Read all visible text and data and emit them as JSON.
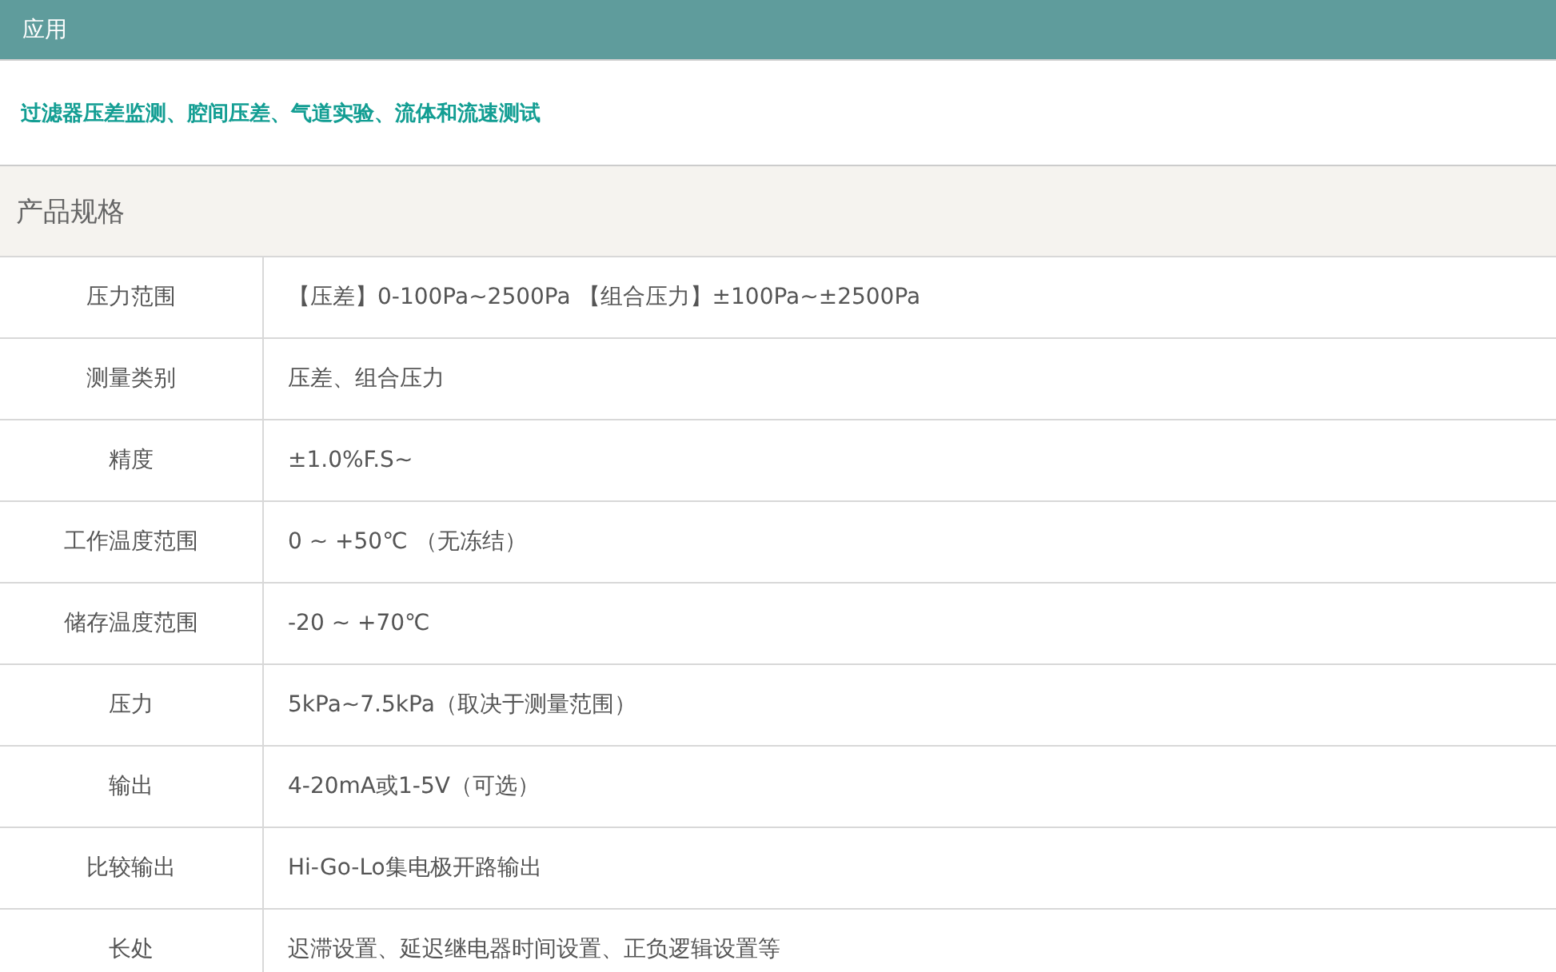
{
  "application": {
    "title": "应用",
    "text": "过滤器压差监测、腔间压差、气道实验、流体和流速测试"
  },
  "specs": {
    "title": "产品规格",
    "rows": [
      {
        "label": "压力范围",
        "value": "【压差】0-100Pa~2500Pa 【组合压力】±100Pa~±2500Pa"
      },
      {
        "label": "测量类别",
        "value": "压差、组合压力"
      },
      {
        "label": "精度",
        "value": "±1.0%F.S~"
      },
      {
        "label": "工作温度范围",
        "value": "0 ~ +50℃ （无冻结）"
      },
      {
        "label": "储存温度范围",
        "value": "-20 ~ +70℃"
      },
      {
        "label": "压力",
        "value": "5kPa~7.5kPa（取决于测量范围）"
      },
      {
        "label": "输出",
        "value": "4-20mA或1-5V（可选）"
      },
      {
        "label": "比较输出",
        "value": "Hi-Go-Lo集电极开路输出"
      },
      {
        "label": "长处",
        "value": "迟滞设置、延迟继电器时间设置、正负逻辑设置等"
      }
    ]
  }
}
